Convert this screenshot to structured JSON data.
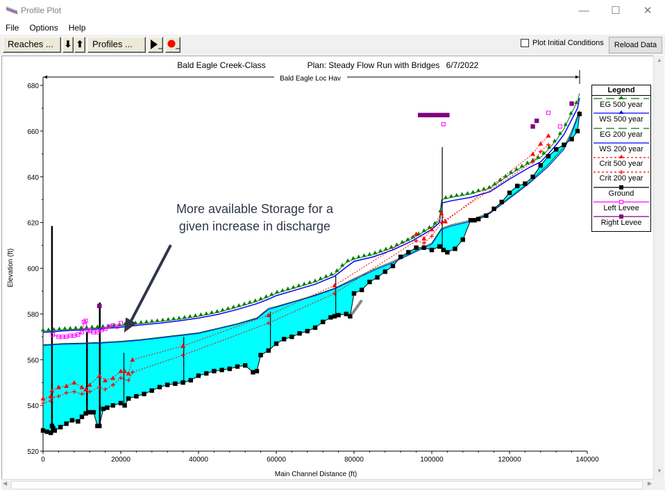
{
  "window": {
    "title": "Profile Plot",
    "controls": {
      "minimize": "—",
      "maximize": "☐",
      "close": "✕"
    }
  },
  "menu": [
    "File",
    "Options",
    "Help"
  ],
  "toolbar": {
    "reaches_label": "Reaches ...",
    "down_label": "⬇",
    "up_label": "⬆",
    "profiles_label": "Profiles ...",
    "play_icon": "play-icon",
    "record_icon": "record-icon",
    "plot_initial_conditions_label": "Plot Initial Conditions",
    "plot_initial_conditions_checked": false,
    "reload_label": "Reload Data"
  },
  "annotation": {
    "line1": "More available Storage for a",
    "line2": "given increase in discharge"
  },
  "colors": {
    "water": "#00ffff",
    "eg": "#007a00",
    "ws": "#0000ff",
    "crit": "#ff0000",
    "ground": "#000000",
    "left_levee": "#ff00ff",
    "right_levee": "#800080",
    "arrow": "#2e3748"
  },
  "chart_data": {
    "type": "line",
    "title": "Bald Eagle Creek-Class       Plan: Steady Flow Run with Bridges     6/7/2022",
    "title_parts": [
      "Bald Eagle Creek-Class",
      "Plan: Steady Flow Run with Bridges",
      "6/7/2022"
    ],
    "reach_label": "Bald Eagle Loc Hav",
    "xlabel": "Main Channel Distance (ft)",
    "ylabel": "Elevation (ft)",
    "xlim": [
      0,
      140000
    ],
    "ylim": [
      520,
      680
    ],
    "xticks": [
      0,
      20000,
      40000,
      60000,
      80000,
      100000,
      120000,
      140000
    ],
    "yticks": [
      520,
      540,
      560,
      580,
      600,
      620,
      640,
      660,
      680
    ],
    "grid": false,
    "legend": {
      "title": "Legend",
      "placement": "right",
      "entries": [
        "EG  500 year",
        "WS  500 year",
        "EG  200 year",
        "WS  200 year",
        "Crit  500 year",
        "Crit  200 year",
        "Ground",
        "Left Levee",
        "Right Levee"
      ]
    },
    "series": [
      {
        "name": "Ground",
        "x": [
          0,
          1000,
          2000,
          2300,
          2600,
          3000,
          4500,
          6000,
          7500,
          9000,
          10000,
          11000,
          12000,
          13000,
          14000,
          14500,
          15500,
          16500,
          18000,
          20000,
          21000,
          22000,
          24000,
          26000,
          28000,
          30000,
          32000,
          34000,
          36000,
          38000,
          40000,
          42000,
          44000,
          46000,
          48000,
          50000,
          52000,
          54000,
          55000,
          56000,
          58000,
          60000,
          62000,
          64000,
          66000,
          68000,
          70000,
          72000,
          74000,
          75000,
          76000,
          78000,
          79000,
          80000,
          82000,
          84000,
          86000,
          88000,
          90000,
          92000,
          94000,
          96000,
          98000,
          100000,
          102000,
          103000,
          104000,
          106000,
          108000,
          110000,
          111000,
          112000,
          114000,
          116000,
          118000,
          120000,
          122000,
          124000,
          126000,
          128000,
          130000,
          132000,
          134000,
          136000,
          137500,
          138000
        ],
        "y": [
          529,
          528.5,
          528,
          531,
          530,
          529,
          530.5,
          532,
          533.5,
          533,
          535,
          536.5,
          537,
          537,
          531,
          531,
          538.5,
          539,
          540,
          541,
          540,
          543,
          544,
          545,
          546.5,
          548,
          549,
          549.5,
          550,
          551,
          553,
          554,
          555,
          555.5,
          556,
          557,
          557.5,
          554.5,
          555,
          562,
          564,
          567,
          569,
          570,
          571.5,
          572.5,
          574,
          576.5,
          578.5,
          579,
          579.5,
          580,
          579,
          589,
          590.5,
          594,
          596,
          598.5,
          601,
          605,
          607,
          609,
          609,
          608,
          609.5,
          608,
          607,
          608.5,
          612.5,
          621,
          621,
          621.5,
          623,
          626,
          629,
          633,
          636,
          637,
          640,
          645,
          649,
          652,
          654,
          656.5,
          660,
          667.5
        ]
      },
      {
        "name": "WS 500 year",
        "x": [
          0,
          2500,
          5000,
          10000,
          15000,
          20000,
          25000,
          30000,
          35000,
          40000,
          45000,
          50000,
          55000,
          58000,
          60000,
          65000,
          70000,
          75000,
          78000,
          80000,
          85000,
          90000,
          95000,
          100000,
          102000,
          102500,
          105000,
          110000,
          115000,
          120000,
          125000,
          128000,
          130000,
          132000,
          134000,
          136000,
          137500,
          138000
        ],
        "y": [
          572,
          572.2,
          572.6,
          573,
          573.5,
          574.2,
          575.2,
          576,
          577,
          578.2,
          579.8,
          582,
          584.5,
          586.5,
          588,
          590.5,
          593,
          596.5,
          600.5,
          603,
          605,
          608,
          612,
          617,
          620,
          628.5,
          629.5,
          631,
          633.5,
          639,
          644,
          646.5,
          650,
          654,
          658.5,
          665,
          670,
          674.5
        ]
      },
      {
        "name": "EG 500 year",
        "x": [
          0,
          2500,
          5000,
          10000,
          15000,
          20000,
          25000,
          30000,
          35000,
          40000,
          45000,
          50000,
          55000,
          58000,
          60000,
          65000,
          70000,
          75000,
          78000,
          80000,
          85000,
          90000,
          95000,
          100000,
          102000,
          102500,
          105000,
          110000,
          115000,
          120000,
          125000,
          128000,
          130000,
          132000,
          134000,
          136000,
          137500,
          138000
        ],
        "y": [
          572.5,
          572.7,
          573.1,
          573.5,
          574,
          574.8,
          575.8,
          576.7,
          577.7,
          579,
          580.7,
          583,
          585.5,
          587.5,
          589,
          591.5,
          594,
          597.5,
          602.5,
          604,
          606,
          609,
          613,
          618,
          621,
          630,
          631,
          632.5,
          635,
          641,
          646,
          648.5,
          652,
          656,
          661,
          668,
          673,
          676.5
        ]
      },
      {
        "name": "WS 200 year",
        "x": [
          0,
          2500,
          5000,
          10000,
          15000,
          20000,
          25000,
          30000,
          35000,
          40000,
          45000,
          50000,
          55000,
          58000,
          60000,
          65000,
          70000,
          75000,
          80000,
          85000,
          90000,
          95000,
          100000,
          102500,
          105000,
          110000,
          115000,
          120000,
          125000,
          130000,
          134000,
          136000,
          138000
        ],
        "y": [
          566.2,
          566.5,
          566.8,
          567,
          567.3,
          567.8,
          568.5,
          569.5,
          570.5,
          571.5,
          573.5,
          575.5,
          578,
          582,
          583,
          585.5,
          588,
          591,
          595,
          599,
          602.5,
          606.5,
          610.5,
          617,
          618.5,
          620.5,
          624,
          630.5,
          637,
          644.5,
          652,
          659,
          668
        ]
      },
      {
        "name": "EG 200 year",
        "x": [
          0,
          2500,
          5000,
          10000,
          15000,
          20000,
          25000,
          30000,
          35000,
          40000,
          45000,
          50000,
          55000,
          58000,
          60000,
          65000,
          70000,
          75000,
          80000,
          85000,
          90000,
          95000,
          100000,
          102500,
          105000,
          110000,
          115000,
          120000,
          125000,
          130000,
          134000,
          136000,
          138000
        ],
        "y": [
          566.5,
          566.8,
          567.1,
          567.3,
          567.6,
          568.1,
          568.8,
          569.8,
          570.8,
          571.8,
          573.8,
          575.8,
          578.3,
          582.5,
          583.3,
          585.8,
          588.3,
          591.3,
          595.5,
          599.5,
          603,
          607,
          611,
          617.5,
          619,
          621,
          624.5,
          631,
          637.5,
          645.5,
          653,
          660,
          669
        ]
      },
      {
        "name": "Crit 500 year",
        "x": [
          0,
          2000,
          2300,
          4000,
          6000,
          8000,
          10000,
          11000,
          12000,
          14500,
          16000,
          18000,
          20000,
          21000,
          22000,
          23000,
          36000,
          58000,
          75000,
          96000,
          98000,
          100000,
          102500,
          103500,
          126000,
          128000,
          130000
        ],
        "y": [
          543,
          544,
          546.5,
          548,
          548.5,
          550,
          548,
          547,
          549,
          553,
          551,
          552,
          555,
          555,
          554,
          560,
          566,
          579.5,
          592.5,
          615,
          613,
          617,
          624,
          620.5,
          650,
          654.5,
          658
        ]
      },
      {
        "name": "Crit 200 year",
        "x": [
          0,
          2000,
          2300,
          4000,
          6000,
          8000,
          10000,
          12000,
          14500,
          16000,
          18000,
          20000,
          22000,
          23000,
          36000,
          58000,
          75000,
          96000,
          98000,
          100000,
          102500,
          126000,
          128000,
          130000
        ],
        "y": [
          541,
          542,
          543.5,
          544,
          545.5,
          546,
          545,
          546,
          548,
          547,
          549,
          552,
          551,
          554.5,
          562,
          576,
          589,
          612,
          611,
          614,
          620,
          646.5,
          651,
          654
        ]
      },
      {
        "name": "Left Levee",
        "x": [
          2500,
          4000,
          5000,
          6000,
          7000,
          8000,
          9000,
          10000,
          10500,
          11000,
          11500,
          12000,
          13000,
          14000,
          15000,
          16000,
          17000,
          18000,
          19000,
          20000,
          103000,
          130000,
          133000
        ],
        "y": [
          571,
          570,
          570,
          570,
          570.5,
          570.5,
          571,
          572,
          576.5,
          577,
          573,
          572.5,
          572,
          572,
          573,
          573.5,
          574.5,
          575,
          574.5,
          576,
          663,
          668,
          662
        ]
      },
      {
        "name": "Right Levee",
        "x": [
          14500,
          97000,
          98000,
          99000,
          100000,
          101000,
          102000,
          103000,
          104000,
          126000,
          127000,
          136000
        ],
        "y": [
          583.5,
          667,
          667,
          667,
          667,
          667,
          667,
          667,
          667,
          662,
          664.5,
          672
        ]
      }
    ],
    "structures": [
      {
        "x": 2300,
        "bottom": 529,
        "top": 618.5
      },
      {
        "x": 11300,
        "bottom": 537,
        "top": 572
      },
      {
        "x": 14600,
        "bottom": 531,
        "top": 585
      },
      {
        "x": 20800,
        "bottom": 541,
        "top": 563
      },
      {
        "x": 36200,
        "bottom": 550,
        "top": 570
      },
      {
        "x": 58500,
        "bottom": 564,
        "top": 581
      },
      {
        "x": 75300,
        "bottom": 579.5,
        "top": 597
      },
      {
        "x": 102700,
        "bottom": 608,
        "top": 653
      }
    ]
  }
}
